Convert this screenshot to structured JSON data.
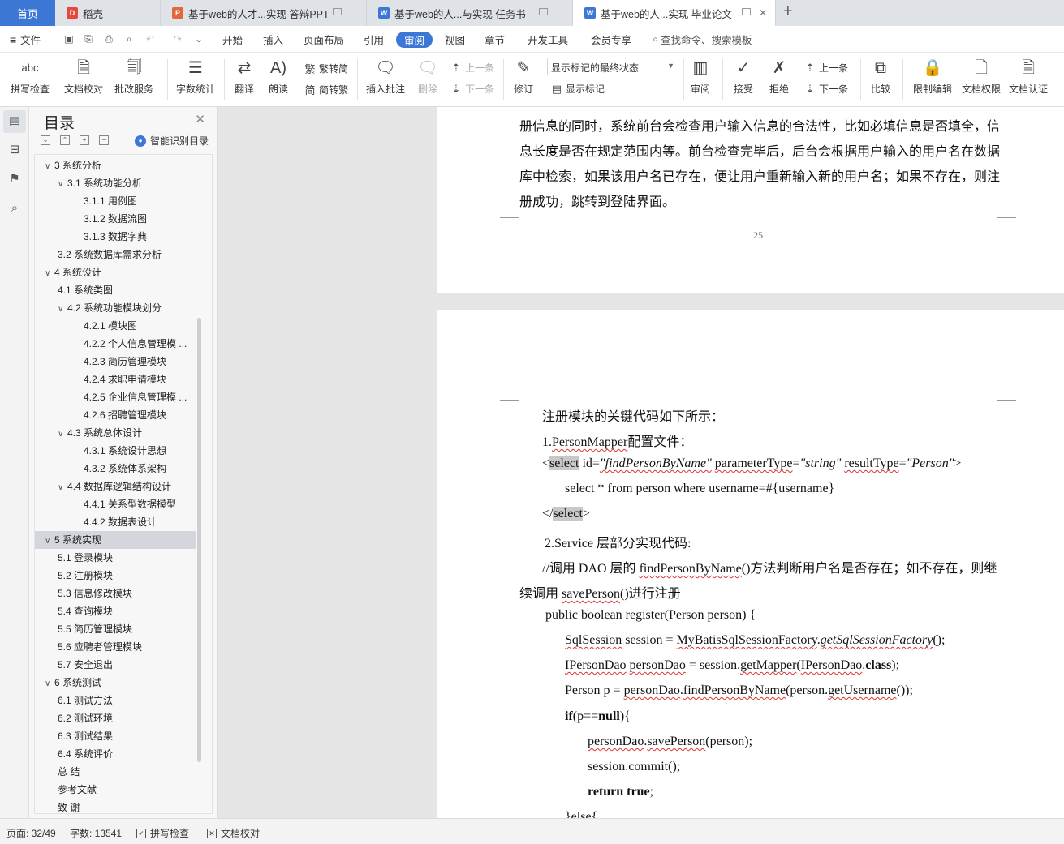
{
  "tabs": {
    "home": "首页",
    "items": [
      {
        "label": "稻壳",
        "icon": "daoke-icon",
        "color": "#e8473d"
      },
      {
        "label": "基于web的人才...实现 答辩PPT",
        "icon": "ppt-icon",
        "color": "#e0683a"
      },
      {
        "label": "基于web的人...与实现 任务书",
        "icon": "word-icon",
        "color": "#3d77d6"
      },
      {
        "label": "基于web的人...实现 毕业论文",
        "icon": "word-icon",
        "color": "#3d77d6"
      }
    ],
    "new_tab": "+"
  },
  "menubar": {
    "file": "文件",
    "items": [
      "开始",
      "插入",
      "页面布局",
      "引用",
      "审阅",
      "视图",
      "章节",
      "开发工具",
      "会员专享"
    ],
    "active": "审阅",
    "search": "查找命令、搜索模板"
  },
  "ribbon": {
    "spellcheck": "拼写检查",
    "doc_check": "文档校对",
    "revise_service": "批改服务",
    "word_count": "字数统计",
    "translate": "翻译",
    "read_aloud": "朗读",
    "to_traditional": "繁转简",
    "to_simplified": "简转繁",
    "insert_comment": "插入批注",
    "delete": "删除",
    "prev": "上一条",
    "next": "下一条",
    "track_changes": "修订",
    "display_mode": "显示标记的最终状态",
    "show_markup": "显示标记",
    "review": "审阅",
    "accept": "接受",
    "reject": "拒绝",
    "prev2": "上一条",
    "next2": "下一条",
    "compare": "比较",
    "restrict_edit": "限制编辑",
    "doc_permission": "文档权限",
    "doc_cert": "文档认证"
  },
  "nav": {
    "title": "目录",
    "smart": "智能识别目录",
    "toc": [
      {
        "level": 1,
        "text": "3  系统分析",
        "chev": "v"
      },
      {
        "level": 2,
        "text": "3.1  系统功能分析",
        "chev": "v"
      },
      {
        "level": 3,
        "text": "3.1.1  用例图"
      },
      {
        "level": 3,
        "text": "3.1.2  数据流图"
      },
      {
        "level": 3,
        "text": "3.1.3  数据字典"
      },
      {
        "level": 2,
        "text": "3.2  系统数据库需求分析"
      },
      {
        "level": 1,
        "text": "4  系统设计",
        "chev": "v"
      },
      {
        "level": 2,
        "text": "4.1 系统类图"
      },
      {
        "level": 2,
        "text": "4.2 系统功能模块划分",
        "chev": "v"
      },
      {
        "level": 3,
        "text": "4.2.1  模块图"
      },
      {
        "level": 3,
        "text": "4.2.2  个人信息管理模 ..."
      },
      {
        "level": 3,
        "text": "4.2.3  简历管理模块"
      },
      {
        "level": 3,
        "text": "4.2.4  求职申请模块"
      },
      {
        "level": 3,
        "text": "4.2.5  企业信息管理模 ..."
      },
      {
        "level": 3,
        "text": "4.2.6  招聘管理模块"
      },
      {
        "level": 2,
        "text": "4.3 系统总体设计",
        "chev": "v"
      },
      {
        "level": 3,
        "text": "4.3.1  系统设计思想"
      },
      {
        "level": 3,
        "text": "4.3.2  系统体系架构"
      },
      {
        "level": 2,
        "text": "4.4  数据库逻辑结构设计",
        "chev": "v"
      },
      {
        "level": 3,
        "text": "4.4.1  关系型数据模型"
      },
      {
        "level": 3,
        "text": "4.4.2  数据表设计"
      },
      {
        "level": 1,
        "text": "5  系统实现",
        "chev": "v",
        "selected": true
      },
      {
        "level": 2,
        "text": "5.1  登录模块"
      },
      {
        "level": 2,
        "text": "5.2  注册模块"
      },
      {
        "level": 2,
        "text": "5.3  信息修改模块"
      },
      {
        "level": 2,
        "text": "5.4  查询模块"
      },
      {
        "level": 2,
        "text": "5.5  简历管理模块"
      },
      {
        "level": 2,
        "text": "5.6  应聘者管理模块"
      },
      {
        "level": 2,
        "text": "5.7  安全退出"
      },
      {
        "level": 1,
        "text": "6  系统测试",
        "chev": "v"
      },
      {
        "level": 2,
        "text": "6.1  测试方法"
      },
      {
        "level": 2,
        "text": "6.2 测试环境"
      },
      {
        "level": 2,
        "text": "6.3 测试结果"
      },
      {
        "level": 2,
        "text": "6.4 系统评价"
      },
      {
        "level": 0,
        "text": "总    结"
      },
      {
        "level": 0,
        "text": "参考文献"
      },
      {
        "level": 0,
        "text": "致  谢"
      }
    ]
  },
  "page1": {
    "lines": [
      "册信息的同时，系统前台会检查用户输入信息的合法性，比如必填信息是否填全，信",
      "息长度是否在规定范围内等。前台检查完毕后，后台会根据用户输入的用户名在数据",
      "库中检索，如果该用户名已存在，便让用户重新输入新的用户名；如果不存在，则注",
      "册成功，跳转到登陆界面。"
    ],
    "page_number": "25"
  },
  "page2": {
    "l1": "注册模块的关键代码如下所示：",
    "l2a": "1.",
    "l2b": "PersonMapper",
    "l2c": "配置文件：",
    "l3_lt": "<",
    "l3_select": "select",
    "l3_id": " id=",
    "l3_idv": "\"findPersonByName\"",
    "l3_pt": "parameterType",
    "l3_eq1": "=",
    "l3_ptv": "\"string\"",
    "l3_rt": "resultType",
    "l3_eq2": "=",
    "l3_rtv": "\"Person\"",
    "l3_gt": ">",
    "l4": "select * from person where username=#{username}",
    "l5_lt": "</",
    "l5_select": "select",
    "l5_gt": ">",
    "l6": "2.Service 层部分实现代码:",
    "l7a": "//调用 DAO 层的 ",
    "l7b": "findPersonByName",
    "l7c": "()方法判断用户名是否存在；如不存在，则继",
    "l8a": "续调用 ",
    "l8b": "savePerson",
    "l8c": "()进行注册",
    "l9": "public boolean register(Person person) {",
    "l10a": "SqlSession",
    "l10b": " session = ",
    "l10c": "MyBatisSqlSessionFactory",
    "l10d": ".",
    "l10e": "getSqlSessionFactory",
    "l10f": "();",
    "l11a": "IPersonDao",
    "l11b": " ",
    "l11c": "personDao",
    "l11d": " = session.",
    "l11e": "getMapper",
    "l11f": "(",
    "l11g": "IPersonDao",
    "l11h": ".",
    "l11i": "class",
    "l11j": ");",
    "l12a": "Person p = ",
    "l12b": "personDao",
    "l12c": ".",
    "l12d": "findPersonByName",
    "l12e": "(person.",
    "l12f": "getUsername",
    "l12g": "());",
    "l13a": "if",
    "l13b": "(p==",
    "l13c": "null",
    "l13d": "){",
    "l14a": "personDao",
    "l14b": ".",
    "l14c": "savePerson",
    "l14d": "(person);",
    "l15": "session.commit();",
    "l16a": "return true",
    "l16b": ";",
    "l17": "}else{"
  },
  "status": {
    "page": "页面: 32/49",
    "words": "字数: 13541",
    "spell": "拼写检查",
    "proof": "文档校对"
  }
}
